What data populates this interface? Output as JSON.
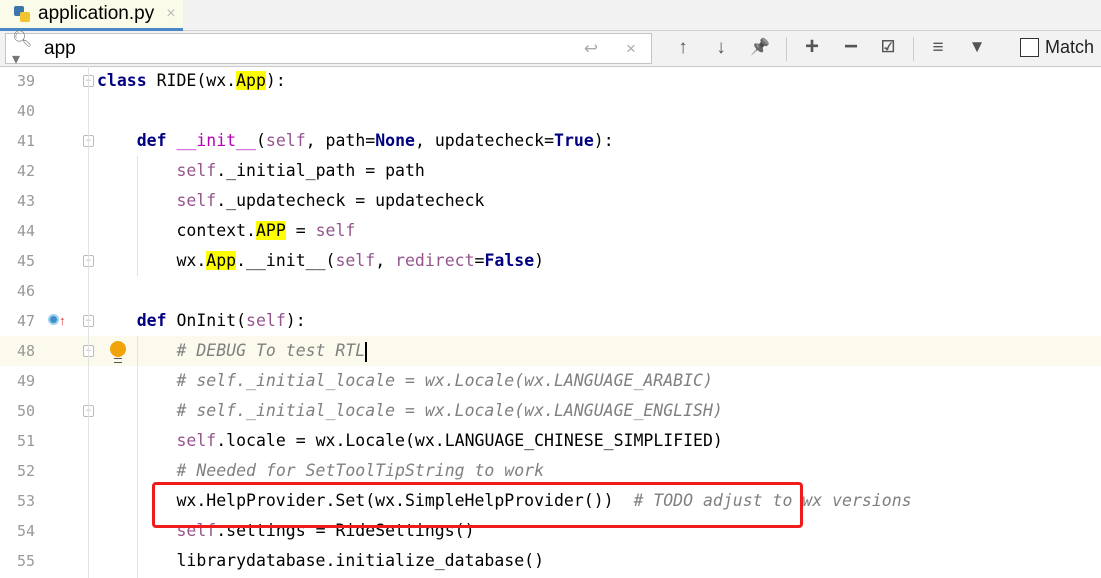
{
  "tab": {
    "label": "application.py",
    "close": "×",
    "icon": "python-file-icon"
  },
  "search": {
    "value": "app",
    "icon": "search-icon",
    "enter": "↩",
    "clear": "×",
    "toolbar": {
      "prev": "↑",
      "next": "↓",
      "pin": "📌",
      "add": "+",
      "remove": "−",
      "select": "☑",
      "filter_lines": "≡",
      "filter": "▼"
    },
    "match_label": "Match",
    "match_checked": false
  },
  "lines": [
    {
      "n": "39",
      "tokens": [
        [
          "class",
          "kw"
        ],
        [
          " RIDE(wx.",
          ""
        ],
        [
          "App",
          "hl"
        ],
        [
          "):",
          ""
        ]
      ]
    },
    {
      "n": "40",
      "tokens": []
    },
    {
      "n": "41",
      "tokens": [
        [
          "    ",
          ""
        ],
        [
          "def",
          "kw"
        ],
        [
          " ",
          ""
        ],
        [
          "__init__",
          "kw2"
        ],
        [
          "(",
          ""
        ],
        [
          "self",
          "self"
        ],
        [
          ", path=",
          ""
        ],
        [
          "None",
          "kw"
        ],
        [
          ", updatecheck=",
          ""
        ],
        [
          "True",
          "kw"
        ],
        [
          "):",
          ""
        ]
      ]
    },
    {
      "n": "42",
      "tokens": [
        [
          "        ",
          ""
        ],
        [
          "self",
          "self"
        ],
        [
          "._initial_path = path",
          ""
        ]
      ]
    },
    {
      "n": "43",
      "tokens": [
        [
          "        ",
          ""
        ],
        [
          "self",
          "self"
        ],
        [
          "._updatecheck = updatecheck",
          ""
        ]
      ]
    },
    {
      "n": "44",
      "tokens": [
        [
          "        context.",
          ""
        ],
        [
          "APP",
          "hl"
        ],
        [
          " = ",
          ""
        ],
        [
          "self",
          "self"
        ]
      ]
    },
    {
      "n": "45",
      "tokens": [
        [
          "        wx.",
          ""
        ],
        [
          "App",
          "hl"
        ],
        [
          ".__init__(",
          ""
        ],
        [
          "self",
          "self"
        ],
        [
          ", ",
          ""
        ],
        [
          "redirect",
          "self"
        ],
        [
          "=",
          ""
        ],
        [
          "False",
          "kw"
        ],
        [
          ")",
          ""
        ]
      ]
    },
    {
      "n": "46",
      "tokens": []
    },
    {
      "n": "47",
      "tokens": [
        [
          "    ",
          ""
        ],
        [
          "def",
          "kw"
        ],
        [
          " OnInit(",
          ""
        ],
        [
          "self",
          "self"
        ],
        [
          "):",
          ""
        ]
      ]
    },
    {
      "n": "48",
      "tokens": [
        [
          "        ",
          ""
        ],
        [
          "# DEBUG To test RTL",
          "cm"
        ]
      ]
    },
    {
      "n": "49",
      "tokens": [
        [
          "        ",
          ""
        ],
        [
          "# self._initial_locale = wx.Locale(wx.LANGUAGE_ARABIC)",
          "cm"
        ]
      ]
    },
    {
      "n": "50",
      "tokens": [
        [
          "        ",
          ""
        ],
        [
          "# self._initial_locale = wx.Locale(wx.LANGUAGE_ENGLISH)",
          "cm"
        ]
      ]
    },
    {
      "n": "51",
      "tokens": [
        [
          "        ",
          ""
        ],
        [
          "self",
          "self"
        ],
        [
          ".locale = wx.Locale(wx.LANGUAGE_CHINESE_SIMPLIFIED)",
          ""
        ]
      ]
    },
    {
      "n": "52",
      "tokens": [
        [
          "        ",
          ""
        ],
        [
          "# Needed for SetToolTipString to work",
          "cm"
        ]
      ]
    },
    {
      "n": "53",
      "tokens": [
        [
          "        wx.HelpProvider.Set(wx.SimpleHelpProvider())  ",
          ""
        ],
        [
          "# TODO adjust to wx versions",
          "cm"
        ]
      ]
    },
    {
      "n": "54",
      "tokens": [
        [
          "        ",
          ""
        ],
        [
          "self",
          "self"
        ],
        [
          ".settings = RideSettings()",
          ""
        ]
      ]
    },
    {
      "n": "55",
      "tokens": [
        [
          "        librarydatabase.initialize_database()",
          ""
        ]
      ]
    }
  ],
  "current_line": "48",
  "highlight_box_line": "51",
  "colors": {
    "keyword": "#000080",
    "self": "#94558d",
    "comment": "#808080",
    "match_highlight": "#ffff00",
    "annotation_box": "#ee1c1c",
    "tab_underline": "#4a88c7"
  }
}
